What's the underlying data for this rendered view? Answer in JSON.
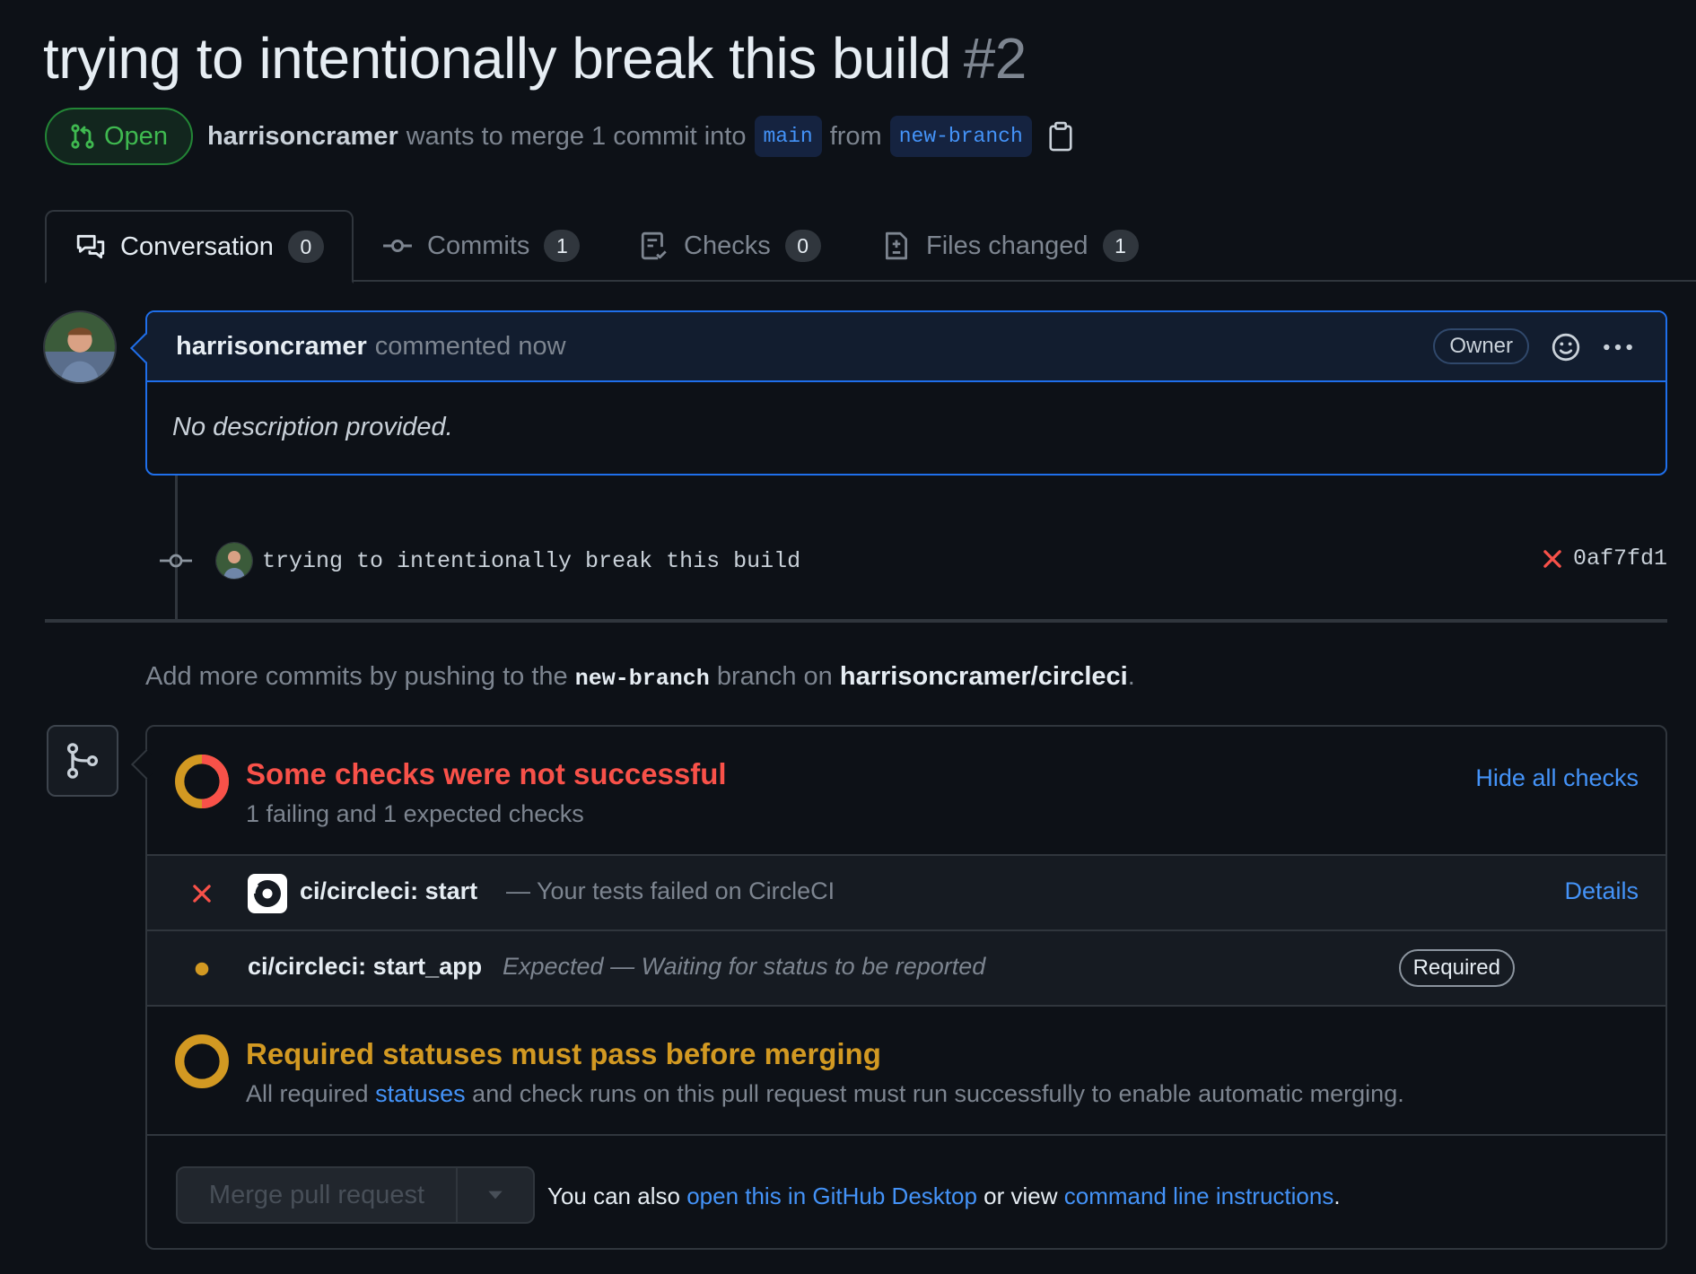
{
  "pr": {
    "title": "trying to intentionally break this build",
    "number": "#2",
    "state": "Open",
    "author": "harrisoncramer",
    "merge_text": "wants to merge 1 commit into",
    "base_branch": "main",
    "from_text": "from",
    "head_branch": "new-branch"
  },
  "tabs": [
    {
      "label": "Conversation",
      "count": "0"
    },
    {
      "label": "Commits",
      "count": "1"
    },
    {
      "label": "Checks",
      "count": "0"
    },
    {
      "label": "Files changed",
      "count": "1"
    }
  ],
  "comment": {
    "author": "harrisoncramer",
    "action": "commented now",
    "badge": "Owner",
    "body": "No description provided."
  },
  "commit": {
    "message": "trying to intentionally break this build",
    "sha": "0af7fd1"
  },
  "push_note": {
    "prefix": "Add more commits by pushing to the",
    "branch": "new-branch",
    "middle": "branch on",
    "repo": "harrisoncramer/circleci",
    "suffix": "."
  },
  "checks": {
    "title": "Some checks were not successful",
    "subtitle": "1 failing and 1 expected checks",
    "hide_label": "Hide all checks",
    "rows": [
      {
        "name": "ci/circleci: start",
        "description": "— Your tests failed on CircleCI",
        "action": "Details"
      },
      {
        "name": "ci/circleci: start_app",
        "description": "Expected — Waiting for status to be reported",
        "badge": "Required"
      }
    ]
  },
  "required": {
    "title": "Required statuses must pass before merging",
    "prefix": "All required",
    "link": "statuses",
    "suffix": "and check runs on this pull request must run successfully to enable automatic merging."
  },
  "merge": {
    "button": "Merge pull request",
    "note_prefix": "You can also",
    "desktop_link": "open this in GitHub Desktop",
    "note_middle": "or view",
    "cli_link": "command line instructions",
    "note_suffix": "."
  },
  "colors": {
    "open_green": "#3fb950",
    "fail_red": "#f85149",
    "pending_yellow": "#d29922",
    "link_blue": "#4493f8",
    "active_border": "#1f6feb"
  }
}
